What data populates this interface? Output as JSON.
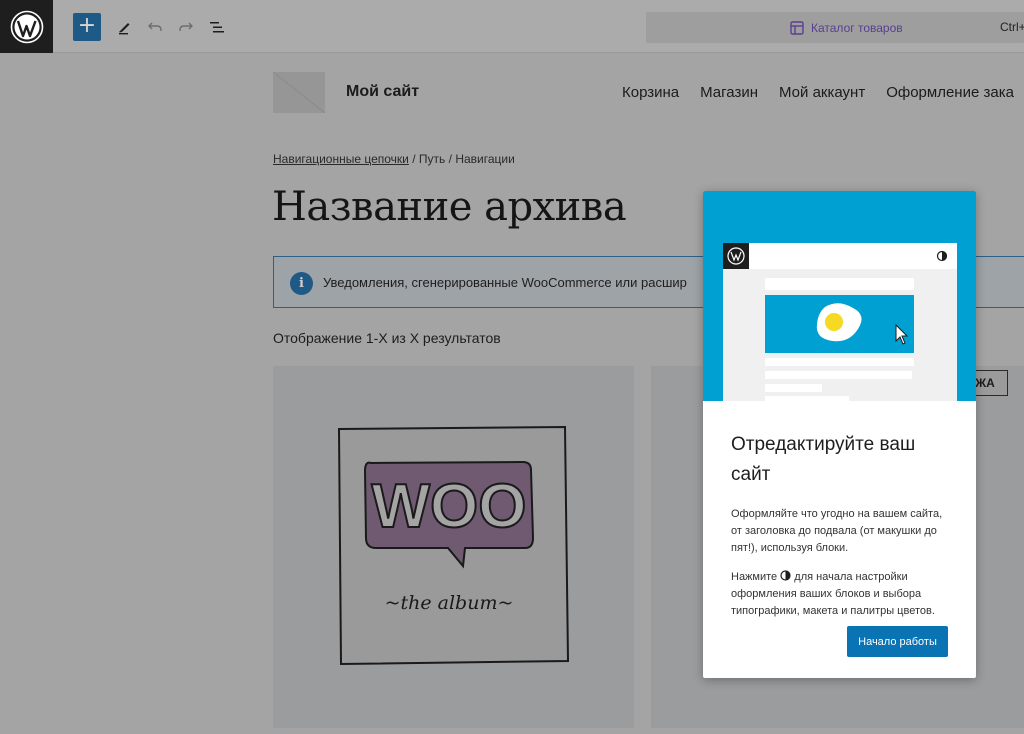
{
  "toolbar": {
    "command_bar_title": "Каталог товаров",
    "command_bar_shortcut": "Ctrl+"
  },
  "site": {
    "title": "Мой сайт",
    "nav": [
      "Корзина",
      "Магазин",
      "Мой аккаунт",
      "Оформление зака"
    ]
  },
  "breadcrumbs": {
    "link": "Навигационные цепочки",
    "sep1": "/",
    "path": "Путь",
    "sep2": "/",
    "current": "Навигации"
  },
  "archive_title": "Название архива",
  "notice": {
    "icon": "i",
    "text": "Уведомления, сгенерированные WooCommerce или расшир"
  },
  "results_count": "Отображение 1-X из X результатов",
  "product": {
    "image_text_main": "WOO",
    "image_text_sub": "~the album~",
    "sale_badge": "ЖА"
  },
  "welcome_guide": {
    "heading": "Отредактируйте ваш сайт",
    "paragraph1": "Оформляйте что угодно на вашем сайта, от заголовка до подвала (от макушки до пят!), используя блоки.",
    "paragraph2_before": "Нажмите",
    "paragraph2_after": "для начала настройки оформления ваших блоков и выбора типографики, макета и палитры цветов.",
    "button": "Начало работы"
  },
  "icons": [
    "wordpress-logo",
    "plus-icon",
    "pencil-icon",
    "undo-icon",
    "redo-icon",
    "list-view-icon",
    "layout-icon",
    "info-icon",
    "half-circle-icon",
    "cursor-icon"
  ]
}
